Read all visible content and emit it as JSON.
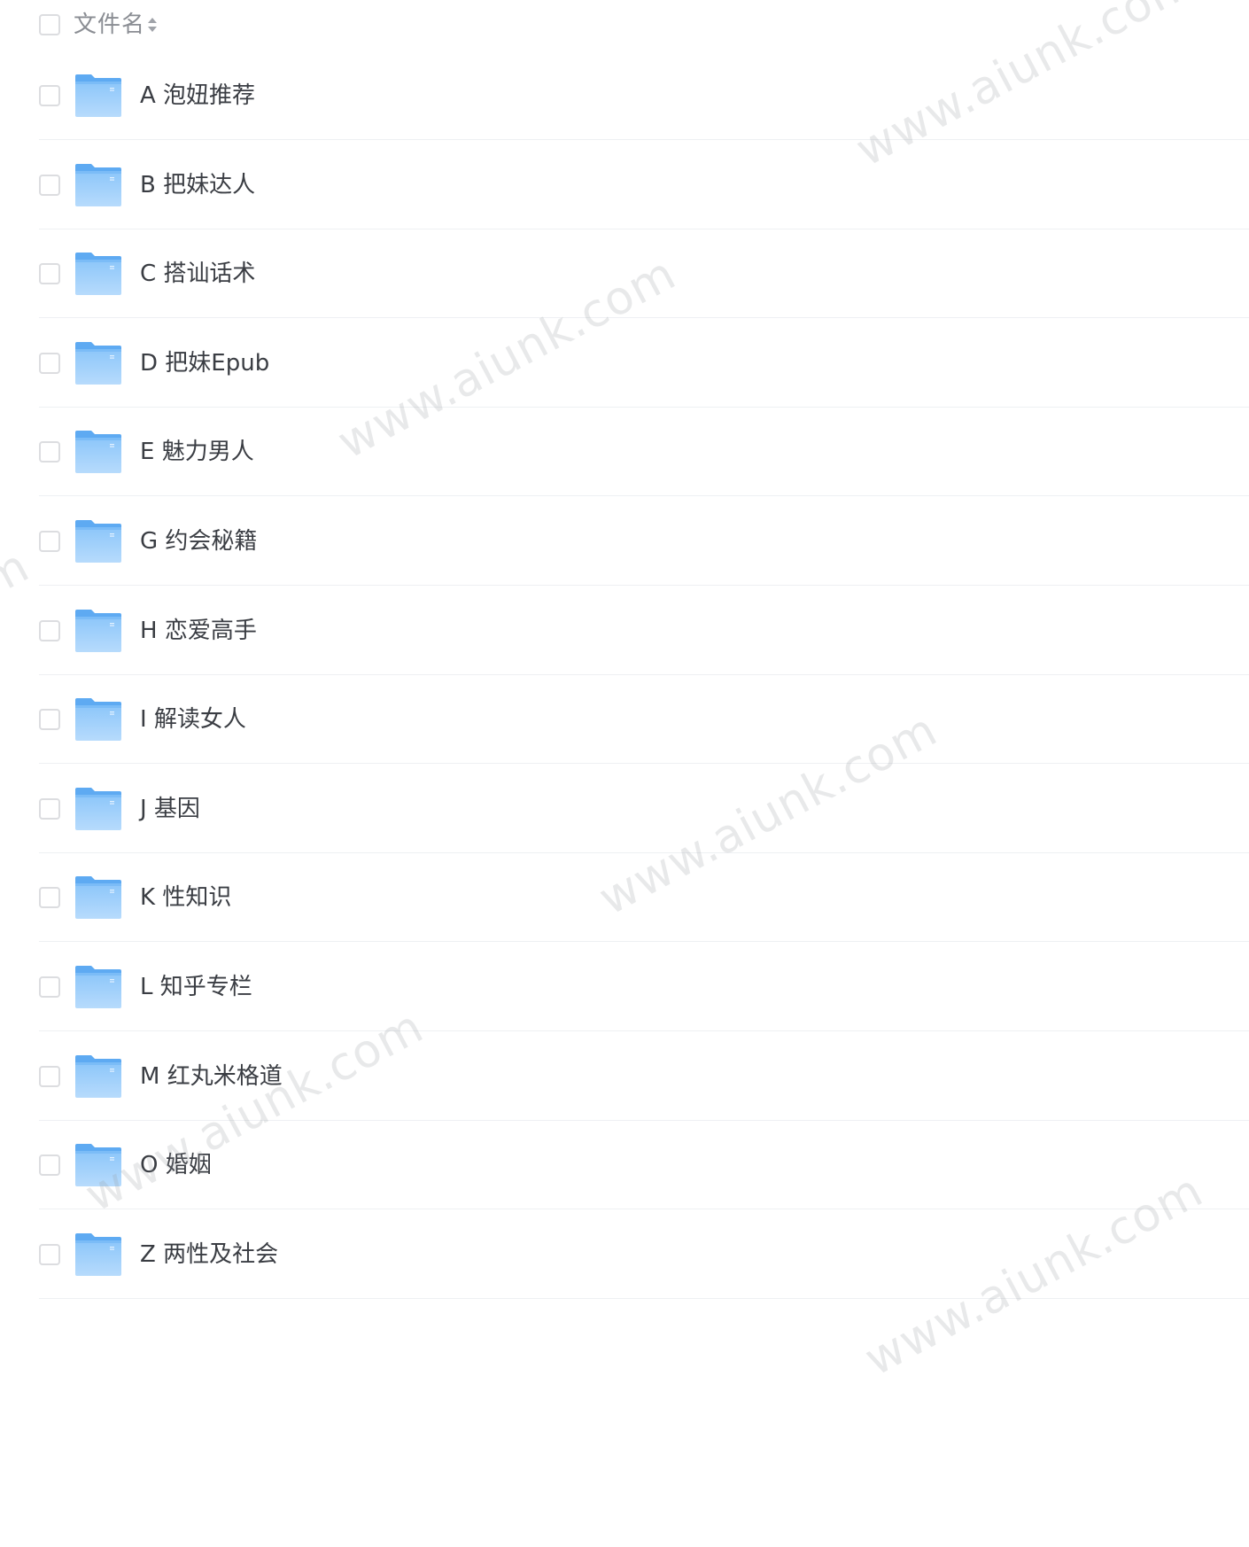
{
  "header": {
    "column_label": "文件名",
    "sort_icon": "sort-updown-icon"
  },
  "folder_icon": "folder-icon",
  "colors": {
    "folder_light": "#a9d3fb",
    "folder_dark": "#6bb4f5",
    "checkbox_border": "#dcdde0",
    "divider": "#eef0f3",
    "text": "#3a3d43",
    "header_text": "#8a8d93"
  },
  "files": [
    {
      "name": "A 泡妞推荐"
    },
    {
      "name": "B 把妹达人"
    },
    {
      "name": "C 搭讪话术"
    },
    {
      "name": "D 把妹Epub"
    },
    {
      "name": "E 魅力男人"
    },
    {
      "name": "G 约会秘籍"
    },
    {
      "name": "H 恋爱高手"
    },
    {
      "name": "I 解读女人"
    },
    {
      "name": "J 基因"
    },
    {
      "name": "K 性知识"
    },
    {
      "name": "L 知乎专栏"
    },
    {
      "name": "M 红丸米格道"
    },
    {
      "name": "O 婚姻"
    },
    {
      "name": "Z 两性及社会"
    }
  ],
  "watermark_text": "www.aiunk.com"
}
